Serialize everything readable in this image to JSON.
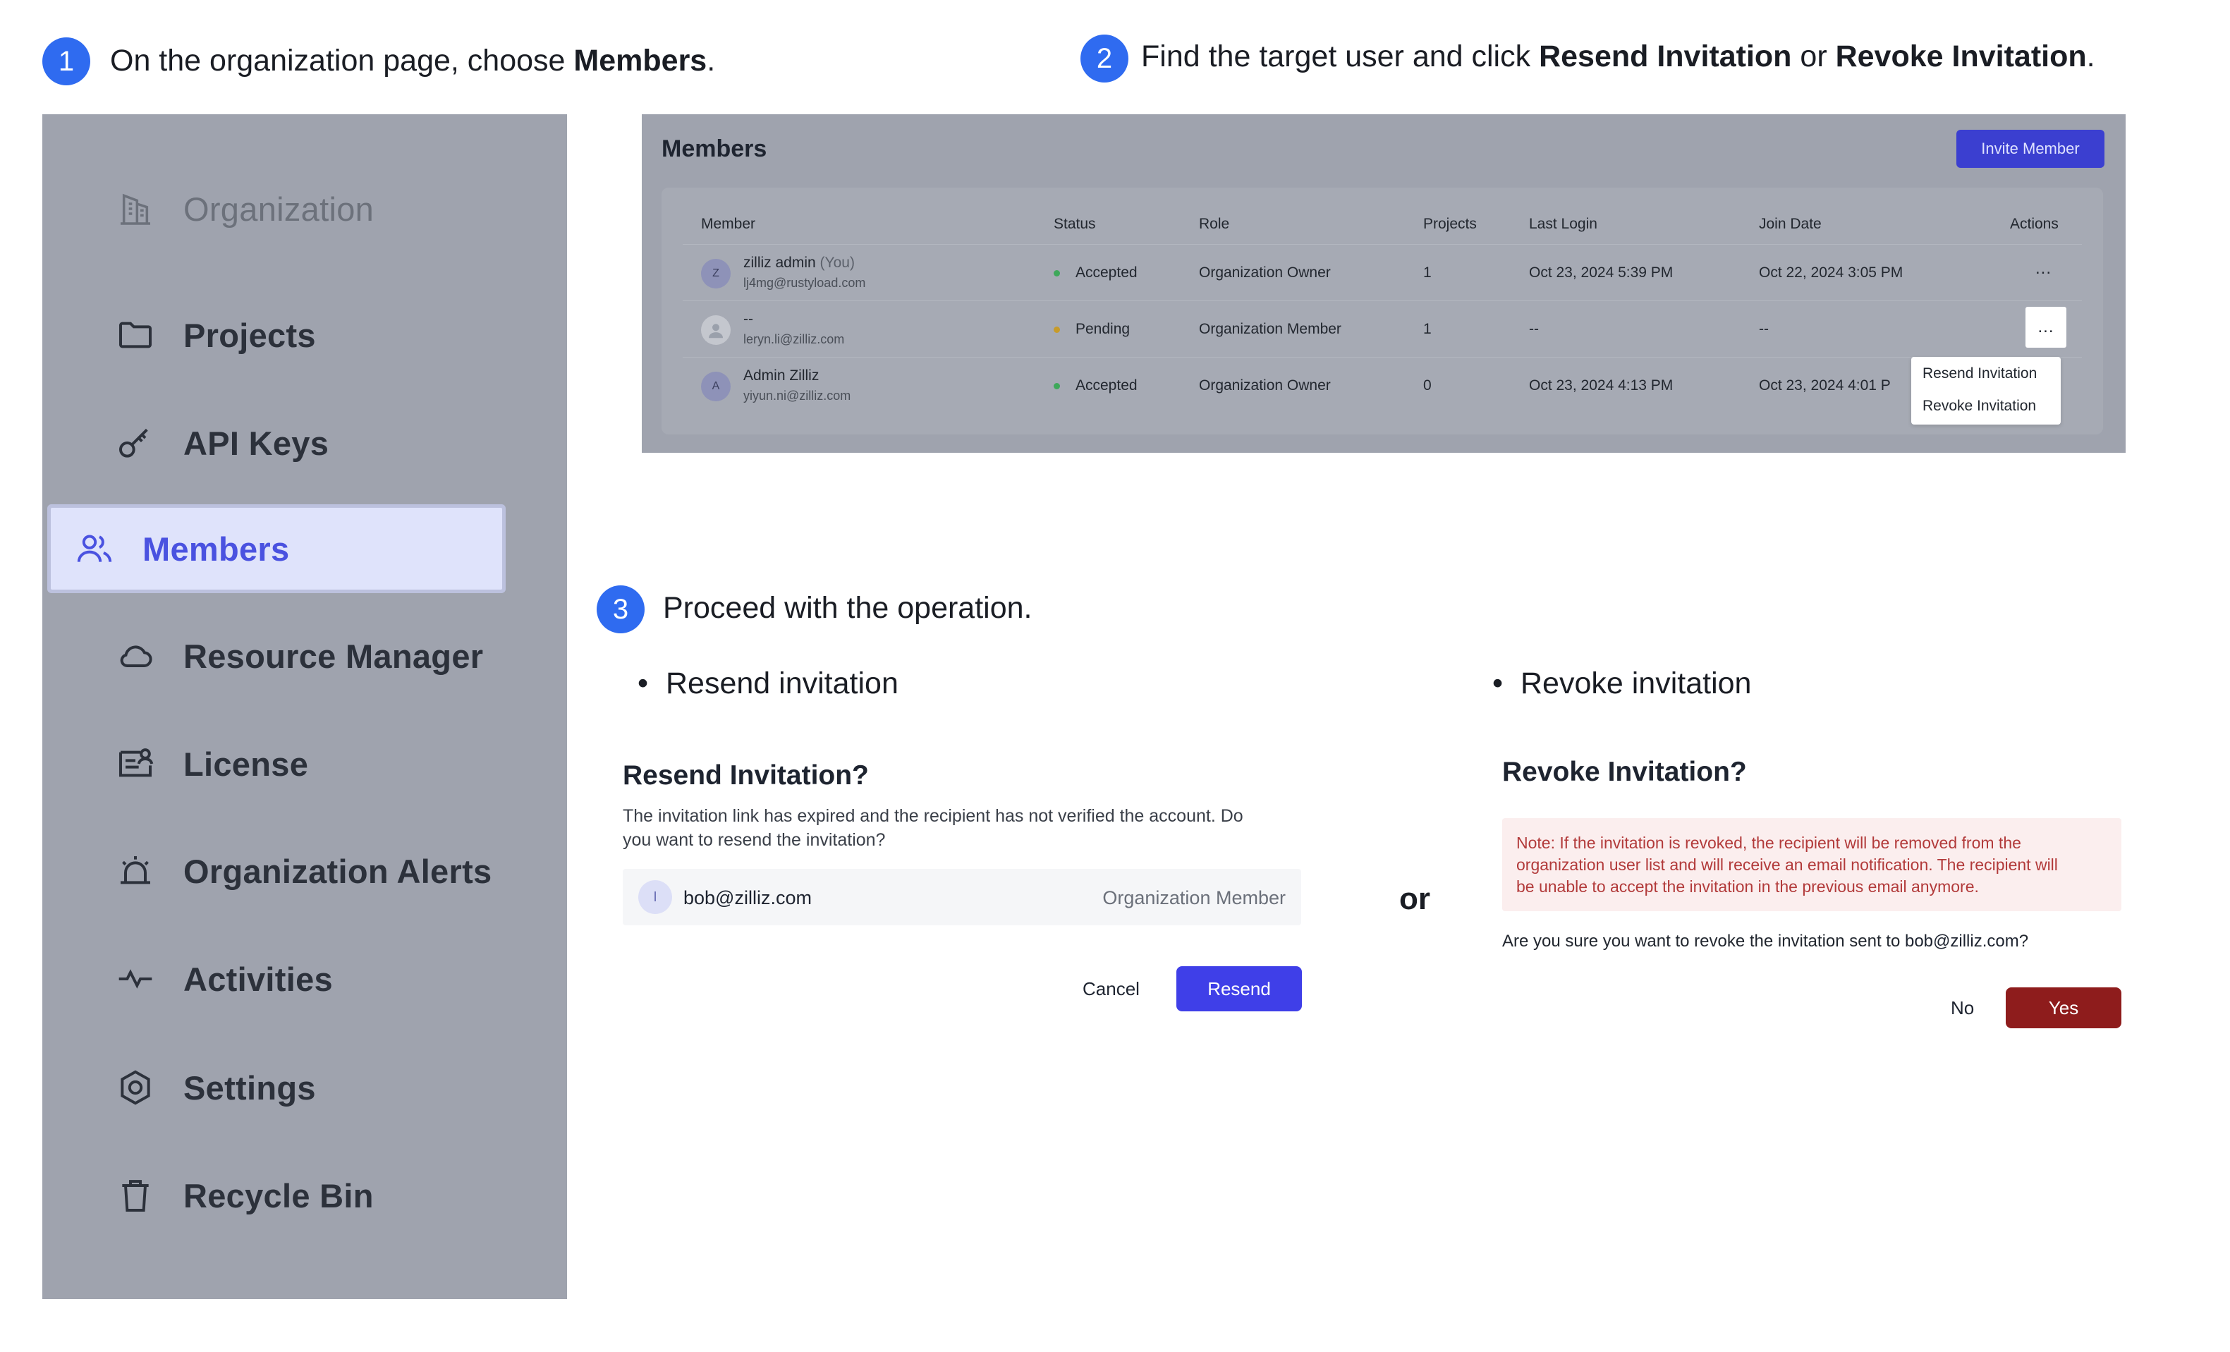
{
  "step1": {
    "number": "1",
    "text_prefix": "On the organization page, choose ",
    "text_bold": "Members",
    "text_suffix": "."
  },
  "step2": {
    "number": "2",
    "text_prefix": "Find the target user and click ",
    "bold1": "Resend Invitation",
    "middle": " or ",
    "bold2": "Revoke Invitation",
    "text_suffix": "."
  },
  "step3": {
    "number": "3",
    "text": "Proceed with the operation."
  },
  "sidebar": {
    "items": [
      {
        "label": "Organization",
        "icon": "building-icon"
      },
      {
        "label": "Projects",
        "icon": "folder-icon"
      },
      {
        "label": "API Keys",
        "icon": "key-icon"
      },
      {
        "label": "Members",
        "icon": "users-icon",
        "active": true
      },
      {
        "label": "Resource Manager",
        "icon": "cloud-icon"
      },
      {
        "label": "License",
        "icon": "license-icon"
      },
      {
        "label": "Organization Alerts",
        "icon": "alarm-icon"
      },
      {
        "label": "Activities",
        "icon": "activity-icon"
      },
      {
        "label": "Settings",
        "icon": "gear-icon"
      },
      {
        "label": "Recycle Bin",
        "icon": "trash-icon"
      }
    ]
  },
  "members": {
    "title": "Members",
    "invite_label": "Invite Member",
    "columns": [
      "Member",
      "Status",
      "Role",
      "Projects",
      "Last Login",
      "Join Date",
      "Actions"
    ],
    "rows": [
      {
        "avatar": "Z",
        "name": "zilliz admin",
        "you": "(You)",
        "email": "lj4mg@rustyload.com",
        "status": "Accepted",
        "role": "Organization Owner",
        "projects": "1",
        "last_login": "Oct 23, 2024 5:39 PM",
        "join_date": "Oct 22, 2024 3:05 PM",
        "actions": "..."
      },
      {
        "avatar": "",
        "name": "--",
        "you": "",
        "email": "leryn.li@zilliz.com",
        "status": "Pending",
        "role": "Organization Member",
        "projects": "1",
        "last_login": "--",
        "join_date": "--",
        "actions": "..."
      },
      {
        "avatar": "A",
        "name": "Admin Zilliz",
        "you": "",
        "email": "yiyun.ni@zilliz.com",
        "status": "Accepted",
        "role": "Organization Owner",
        "projects": "0",
        "last_login": "Oct 23, 2024 4:13 PM",
        "join_date": "Oct 23, 2024 4:01 P",
        "actions": ""
      }
    ],
    "dropdown": [
      "Resend Invitation",
      "Revoke Invitation"
    ]
  },
  "resend": {
    "bullet": "Resend invitation",
    "title": "Resend Invitation?",
    "body_line1": "The invitation link has expired and the recipient has not verified the account. Do",
    "body_line2": "you want to resend the invitation?",
    "recipient_avatar": "I",
    "recipient_email": "bob@zilliz.com",
    "recipient_role": "Organization Member",
    "cancel_label": "Cancel",
    "confirm_label": "Resend"
  },
  "or_label": "or",
  "revoke": {
    "bullet": "Revoke invitation",
    "title": "Revoke Invitation?",
    "note_line1": "Note: If the invitation is revoked, the recipient will be removed from the",
    "note_line2": "organization user list and will receive an email notification. The recipient will",
    "note_line3": "be unable to accept the invitation in the previous email anymore.",
    "question_prefix": "Are you sure you want to revoke the invitation sent to ",
    "question_email": "bob@zilliz.com",
    "question_suffix": "?",
    "no_label": "No",
    "yes_label": "Yes"
  },
  "colors": {
    "accent": "#2f6bf0",
    "primary_button": "#3f3fe8",
    "danger_button": "#8e1c1c",
    "sidebar_bg": "#9fa3ae",
    "active_item": "#4a52e0"
  }
}
